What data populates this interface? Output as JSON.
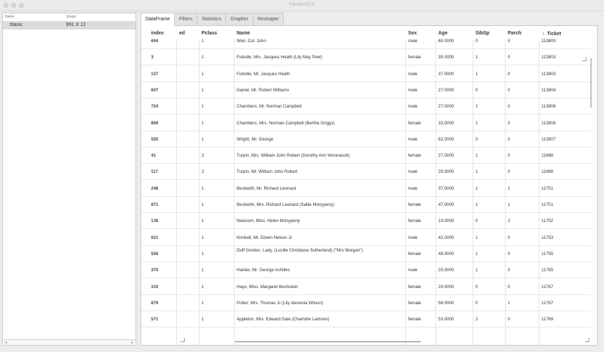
{
  "window": {
    "title": "PandasGUI"
  },
  "left_panel": {
    "headers": [
      "Name",
      "Shape"
    ],
    "rows": [
      {
        "name": "titanic",
        "shape": "891 X 12"
      }
    ]
  },
  "tabs": [
    "DataFrame",
    "Filters",
    "Statistics",
    "Grapher",
    "Reshaper"
  ],
  "active_tab": "DataFrame",
  "table": {
    "columns": [
      "index",
      "ed",
      "Pclass",
      "Name",
      "Sex",
      "Age",
      "SibSp",
      "Parch",
      "Ticket"
    ],
    "sort_column": "Ticket",
    "rows": [
      [
        "694",
        "",
        "1",
        "Weir, Col. John",
        "male",
        "60.0000",
        "0",
        "0",
        "113800"
      ],
      [
        "3",
        "",
        "1",
        "Futrelle, Mrs. Jacques Heath (Lily May Peel)",
        "female",
        "35.0000",
        "1",
        "0",
        "113803"
      ],
      [
        "137",
        "",
        "1",
        "Futrelle, Mr. Jacques Heath",
        "male",
        "37.0000",
        "1",
        "0",
        "113803"
      ],
      [
        "607",
        "",
        "1",
        "Daniel, Mr. Robert Williams",
        "male",
        "27.0000",
        "0",
        "0",
        "113804"
      ],
      [
        "724",
        "",
        "1",
        "Chambers, Mr. Norman Campbell",
        "male",
        "27.0000",
        "1",
        "0",
        "113806"
      ],
      [
        "809",
        "",
        "1",
        "Chambers, Mrs. Norman Campbell (Bertha Griggs)",
        "female",
        "33.0000",
        "1",
        "0",
        "113806"
      ],
      [
        "555",
        "",
        "1",
        "Wright, Mr. George",
        "male",
        "62.0000",
        "0",
        "0",
        "113807"
      ],
      [
        "41",
        "",
        "2",
        "Turpin, Mrs. William John Robert (Dorothy Ann Wonnacott)",
        "female",
        "27.0000",
        "1",
        "0",
        "11668"
      ],
      [
        "117",
        "",
        "2",
        "Turpin, Mr. William John Robert",
        "male",
        "29.0000",
        "1",
        "0",
        "11668"
      ],
      [
        "248",
        "",
        "1",
        "Beckwith, Mr. Richard Leonard",
        "male",
        "37.0000",
        "1",
        "1",
        "11751"
      ],
      [
        "871",
        "",
        "1",
        "Beckwith, Mrs. Richard Leonard (Sallie Monypeny)",
        "female",
        "47.0000",
        "1",
        "1",
        "11751"
      ],
      [
        "136",
        "",
        "1",
        "Newsom, Miss. Helen Monypeny",
        "female",
        "19.0000",
        "0",
        "2",
        "11752"
      ],
      [
        "621",
        "",
        "1",
        "Kimball, Mr. Edwin Nelson Jr",
        "male",
        "42.0000",
        "1",
        "0",
        "11753"
      ],
      [
        "556",
        "",
        "1",
        "Duff Gordon, Lady. (Lucille Christiana Sutherland) (\"Mrs Morgan\")",
        "female",
        "48.0000",
        "1",
        "0",
        "11755"
      ],
      [
        "370",
        "",
        "1",
        "Harder, Mr. George Achilles",
        "male",
        "25.0000",
        "1",
        "0",
        "11765"
      ],
      [
        "310",
        "",
        "1",
        "Hays, Miss. Margaret Bechstein",
        "female",
        "24.0000",
        "0",
        "0",
        "11767"
      ],
      [
        "879",
        "",
        "1",
        "Potter, Mrs. Thomas Jr (Lily Alexenia Wilson)",
        "female",
        "56.0000",
        "0",
        "1",
        "11767"
      ],
      [
        "571",
        "",
        "1",
        "Appleton, Mrs. Edward Dale (Charlotte Lamson)",
        "female",
        "53.0000",
        "2",
        "0",
        "11769"
      ]
    ]
  }
}
